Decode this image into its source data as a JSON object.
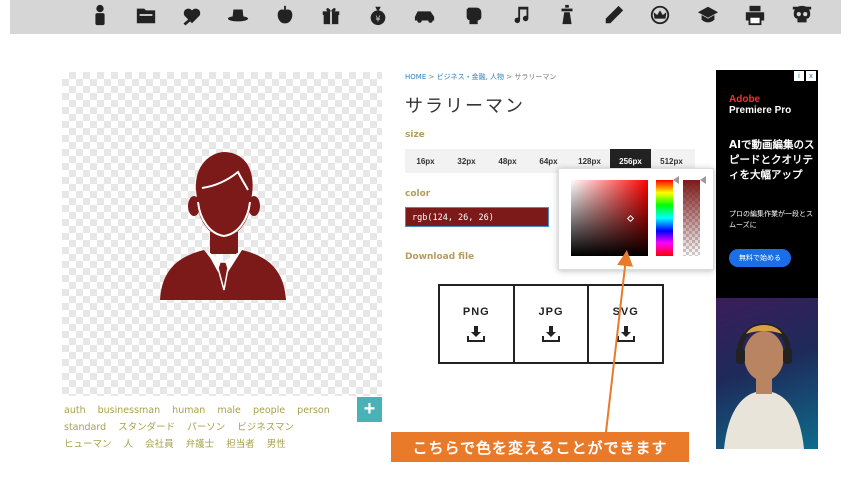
{
  "nav": {
    "icons": [
      {
        "name": "person-icon"
      },
      {
        "name": "folder-icon"
      },
      {
        "name": "medical-icon"
      },
      {
        "name": "hat-icon"
      },
      {
        "name": "apple-icon"
      },
      {
        "name": "gift-icon"
      },
      {
        "name": "money-bag-icon"
      },
      {
        "name": "car-icon"
      },
      {
        "name": "boxing-glove-icon"
      },
      {
        "name": "music-note-icon"
      },
      {
        "name": "lighthouse-icon"
      },
      {
        "name": "pencil-icon"
      },
      {
        "name": "crown-icon"
      },
      {
        "name": "graduation-cap-icon"
      },
      {
        "name": "printer-icon"
      },
      {
        "name": "skull-icon"
      }
    ]
  },
  "breadcrumb": {
    "home": "HOME",
    "sep1": ">",
    "category": "ビジネス・金融, 人物",
    "sep2": ">",
    "current": "サラリーマン"
  },
  "item": {
    "title": "サラリーマン",
    "icon_color": "#7c1a1a"
  },
  "size": {
    "label": "size",
    "options": [
      "16px",
      "32px",
      "48px",
      "64px",
      "128px",
      "256px",
      "512px"
    ],
    "selected": "256px"
  },
  "color": {
    "label": "color",
    "value": "rgb(124, 26, 26)"
  },
  "download": {
    "label": "Download file",
    "formats": [
      "PNG",
      "JPG",
      "SVG"
    ]
  },
  "tags": [
    "auth",
    "businessman",
    "human",
    "male",
    "people",
    "person",
    "standard",
    "スタンダード",
    "パーソン",
    "ビジネスマン",
    "ヒューマン",
    "人",
    "会社員",
    "弁護士",
    "担当者",
    "男性"
  ],
  "add_button": "+",
  "annotation": {
    "text": "こちらで色を変えることができます",
    "color": "#e87a2a"
  },
  "ad": {
    "badge_info": "i",
    "badge_close": "x",
    "brand_line1": "Adobe",
    "brand_line2": "Premiere Pro",
    "headline": "AIで動画編集のスピードとクオリティを大幅アップ",
    "sub": "プロの編集作業が一段とスムーズに",
    "cta": "無料で始める"
  }
}
